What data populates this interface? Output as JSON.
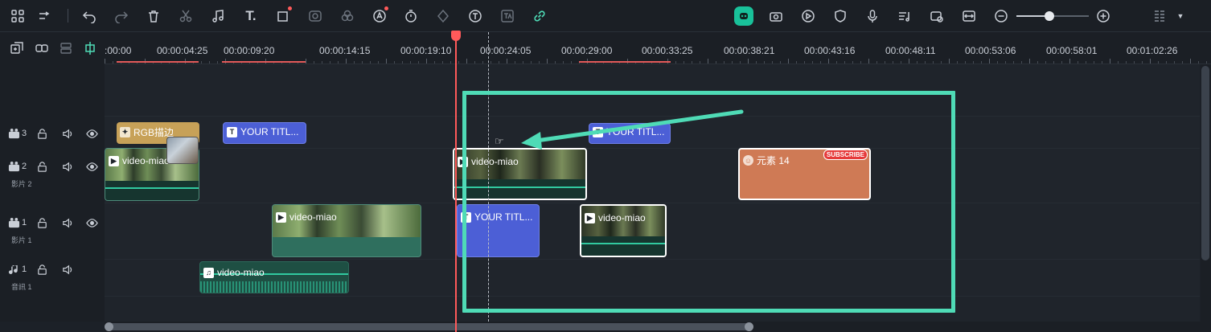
{
  "toolbar": {
    "icons": [
      "layout-icon",
      "split-icon",
      "undo-icon",
      "redo-icon",
      "delete-icon",
      "cut-icon",
      "music-icon",
      "text-icon",
      "crop-icon",
      "mask-icon",
      "color-icon",
      "ai-icon",
      "timer-icon",
      "keyframe-icon",
      "text-to-speech-icon",
      "translate-icon",
      "link-icon",
      "ai-robot-icon",
      "camera-icon",
      "record-icon",
      "shield-icon",
      "mic-icon",
      "audio-list-icon",
      "snapshot-icon",
      "fit-icon",
      "zoom-out-icon",
      "zoom-in-icon",
      "grid-icon"
    ],
    "zoom_level": 0.45
  },
  "ruler": {
    "labels": [
      ":00:00",
      "00:00:04:25",
      "00:00:09:20",
      "00:00:14:15",
      "00:00:19:10",
      "00:00:24:05",
      "00:00:29:00",
      "00:00:33:25",
      "00:00:38:21",
      "00:00:43:16",
      "00:00:48:11",
      "00:00:53:06",
      "00:00:58:01",
      "00:01:02:26"
    ]
  },
  "tracks": [
    {
      "icon": "video-track-icon",
      "number": "3",
      "name": ""
    },
    {
      "icon": "video-track-icon",
      "number": "2",
      "name": "影片 2"
    },
    {
      "icon": "video-track-icon",
      "number": "1",
      "name": "影片 1"
    },
    {
      "icon": "music-track-icon",
      "number": "1",
      "name": "音訊 1"
    }
  ],
  "clips": {
    "rgb_effect": "RGB描边",
    "title_a": "YOUR TITL...",
    "title_b": "YOUR TITL...",
    "title_c": "YOUR TITL...",
    "video_a": "video-miao",
    "video_b": "video-miao",
    "video_c": "video-miao",
    "video_d": "video-miao",
    "audio_a": "video-miao",
    "sticker": "元素 14",
    "sticker_badge": "SUBSCRIBE"
  },
  "colors": {
    "accent": "#4fdbb6",
    "playhead": "#ff5a5a",
    "title_clip": "#4c5fd6",
    "sticker_clip": "#cf7a55",
    "effect_clip": "#c7a158"
  }
}
